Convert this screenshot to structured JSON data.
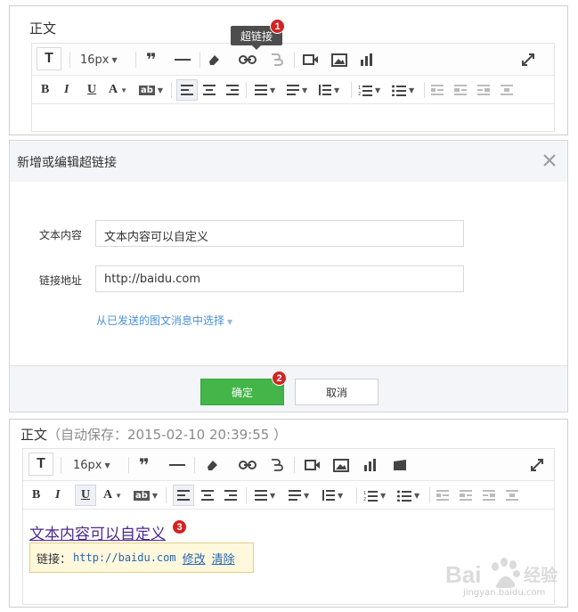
{
  "panel1": {
    "title": "正文",
    "font_size": "16px",
    "tooltip": "超链接",
    "badge": "1"
  },
  "dialog": {
    "title": "新增或编辑超链接",
    "text_label": "文本内容",
    "text_value": "文本内容可以自定义",
    "url_label": "链接地址",
    "url_value": "http://baidu.com",
    "pick_label": "从已发送的图文消息中选择",
    "ok_label": "确定",
    "cancel_label": "取消",
    "badge": "2"
  },
  "panel3": {
    "title": "正文",
    "autosave": "（自动保存：2015-02-10 20:39:55 ）",
    "font_size": "16px",
    "editor_text": "文本内容可以自定义",
    "badge": "3",
    "popup_label": "链接：",
    "popup_url": "http://baidu.com",
    "edit_label": "修改",
    "clear_label": "清除"
  },
  "watermark": {
    "logo": "Baidu 经验",
    "url": "jingyan.baidu.com"
  },
  "colors": {
    "ok_button": "#44b549",
    "badge": "#d42222",
    "link": "#4a90d6"
  }
}
